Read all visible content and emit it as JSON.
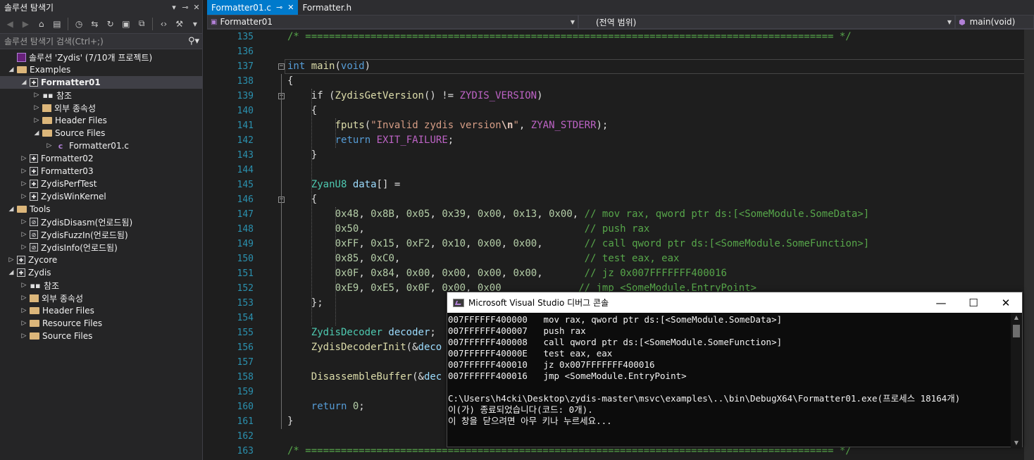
{
  "solution_explorer": {
    "title": "솔루션 탐색기",
    "search_placeholder": "솔루션 탐색기 검색(Ctrl+;)",
    "tree": [
      {
        "label": "솔루션 'Zydis' (7/10개 프로젝트)",
        "depth": 0,
        "expander": "",
        "icon": "solution-icon"
      },
      {
        "label": "Examples",
        "depth": 0,
        "expander": "◢",
        "icon": "folder-icon"
      },
      {
        "label": "Formatter01",
        "depth": 1,
        "expander": "◢",
        "icon": "project-icon",
        "selected": true
      },
      {
        "label": "참조",
        "depth": 2,
        "expander": "▷",
        "icon": "references-icon"
      },
      {
        "label": "외부 종속성",
        "depth": 2,
        "expander": "▷",
        "icon": "external-deps-icon"
      },
      {
        "label": "Header Files",
        "depth": 2,
        "expander": "▷",
        "icon": "folder-icon"
      },
      {
        "label": "Source Files",
        "depth": 2,
        "expander": "◢",
        "icon": "folder-icon"
      },
      {
        "label": "Formatter01.c",
        "depth": 3,
        "expander": "▷",
        "icon": "c-file-icon"
      },
      {
        "label": "Formatter02",
        "depth": 1,
        "expander": "▷",
        "icon": "project-icon"
      },
      {
        "label": "Formatter03",
        "depth": 1,
        "expander": "▷",
        "icon": "project-icon"
      },
      {
        "label": "ZydisPerfTest",
        "depth": 1,
        "expander": "▷",
        "icon": "project-icon"
      },
      {
        "label": "ZydisWinKernel",
        "depth": 1,
        "expander": "▷",
        "icon": "project-icon"
      },
      {
        "label": "Tools",
        "depth": 0,
        "expander": "◢",
        "icon": "folder-icon"
      },
      {
        "label": "ZydisDisasm(언로드됨)",
        "depth": 1,
        "expander": "▷",
        "icon": "unloaded-project-icon"
      },
      {
        "label": "ZydisFuzzIn(언로드됨)",
        "depth": 1,
        "expander": "▷",
        "icon": "unloaded-project-icon"
      },
      {
        "label": "ZydisInfo(언로드됨)",
        "depth": 1,
        "expander": "▷",
        "icon": "unloaded-project-icon"
      },
      {
        "label": "Zycore",
        "depth": 0,
        "expander": "▷",
        "icon": "project-icon"
      },
      {
        "label": "Zydis",
        "depth": 0,
        "expander": "◢",
        "icon": "project-icon"
      },
      {
        "label": "참조",
        "depth": 1,
        "expander": "▷",
        "icon": "references-icon"
      },
      {
        "label": "외부 종속성",
        "depth": 1,
        "expander": "▷",
        "icon": "external-deps-icon"
      },
      {
        "label": "Header Files",
        "depth": 1,
        "expander": "▷",
        "icon": "folder-icon"
      },
      {
        "label": "Resource Files",
        "depth": 1,
        "expander": "▷",
        "icon": "folder-icon"
      },
      {
        "label": "Source Files",
        "depth": 1,
        "expander": "▷",
        "icon": "folder-icon"
      }
    ]
  },
  "tabs": [
    {
      "label": "Formatter01.c",
      "active": true,
      "pin": "⊸",
      "close": "✕"
    },
    {
      "label": "Formatter.h",
      "active": false
    }
  ],
  "navbar": {
    "file_scope": "Formatter01",
    "scope": "(전역 범위)",
    "member": "main(void)"
  },
  "editor": {
    "lines": [
      {
        "n": "135",
        "html": "<span class=\"cm\">/* ========================================================================================= */</span>",
        "indent": 0
      },
      {
        "n": "136",
        "html": "",
        "indent": 0
      },
      {
        "n": "137",
        "html": "<span class=\"kw\">int</span> <span class=\"fn\">main</span>(<span class=\"kw\">void</span>)",
        "indent": 0,
        "fold": "−"
      },
      {
        "n": "138",
        "html": "{",
        "indent": 0
      },
      {
        "n": "139",
        "html": "if (<span class=\"fn\">ZydisGetVersion</span>() != <span class=\"mc\">ZYDIS_VERSION</span>)",
        "indent": 1,
        "fold": "−"
      },
      {
        "n": "140",
        "html": "{",
        "indent": 1
      },
      {
        "n": "141",
        "html": "<span class=\"fn\">fputs</span>(<span class=\"st\">\"Invalid zydis version</span><span class=\"es\">\\n</span><span class=\"st\">\"</span>, <span class=\"mc\">ZYAN_STDERR</span>);",
        "indent": 2
      },
      {
        "n": "142",
        "html": "<span class=\"kw\">return</span> <span class=\"mc\">EXIT_FAILURE</span>;",
        "indent": 2
      },
      {
        "n": "143",
        "html": "}",
        "indent": 1
      },
      {
        "n": "144",
        "html": "",
        "indent": 0
      },
      {
        "n": "145",
        "html": "<span class=\"ty\">ZyanU8</span> <span class=\"vr\">data</span>[] =",
        "indent": 1
      },
      {
        "n": "146",
        "html": "{",
        "indent": 1,
        "fold": "−"
      },
      {
        "n": "147",
        "html": "<span class=\"nm\">0x48</span>, <span class=\"nm\">0x8B</span>, <span class=\"nm\">0x05</span>, <span class=\"nm\">0x39</span>, <span class=\"nm\">0x00</span>, <span class=\"nm\">0x13</span>, <span class=\"nm\">0x00</span>, <span class=\"cm\">// mov rax, qword ptr ds:[&lt;SomeModule.SomeData&gt;]</span>",
        "indent": 2
      },
      {
        "n": "148",
        "html": "<span class=\"nm\">0x50</span>,                                     <span class=\"cm\">// push rax</span>",
        "indent": 2
      },
      {
        "n": "149",
        "html": "<span class=\"nm\">0xFF</span>, <span class=\"nm\">0x15</span>, <span class=\"nm\">0xF2</span>, <span class=\"nm\">0x10</span>, <span class=\"nm\">0x00</span>, <span class=\"nm\">0x00</span>,       <span class=\"cm\">// call qword ptr ds:[&lt;SomeModule.SomeFunction&gt;]</span>",
        "indent": 2
      },
      {
        "n": "150",
        "html": "<span class=\"nm\">0x85</span>, <span class=\"nm\">0xC0</span>,                               <span class=\"cm\">// test eax, eax</span>",
        "indent": 2
      },
      {
        "n": "151",
        "html": "<span class=\"nm\">0x0F</span>, <span class=\"nm\">0x84</span>, <span class=\"nm\">0x00</span>, <span class=\"nm\">0x00</span>, <span class=\"nm\">0x00</span>, <span class=\"nm\">0x00</span>,       <span class=\"cm\">// jz 0x007FFFFFFF400016</span>",
        "indent": 2
      },
      {
        "n": "152",
        "html": "<span class=\"nm\">0xE9</span>, <span class=\"nm\">0xE5</span>, <span class=\"nm\">0x0F</span>, <span class=\"nm\">0x00</span>, <span class=\"nm\">0x00</span>             <span class=\"cm\">// jmp &lt;SomeModule.EntryPoint&gt;</span>",
        "indent": 2
      },
      {
        "n": "153",
        "html": "};",
        "indent": 1
      },
      {
        "n": "154",
        "html": "",
        "indent": 0
      },
      {
        "n": "155",
        "html": "<span class=\"ty\">ZydisDecoder</span> <span class=\"vr\">decoder</span>;",
        "indent": 1
      },
      {
        "n": "156",
        "html": "<span class=\"fn\">ZydisDecoderInit</span>(&amp;<span class=\"vr\">deco</span>",
        "indent": 1
      },
      {
        "n": "157",
        "html": "",
        "indent": 0
      },
      {
        "n": "158",
        "html": "<span class=\"fn\">DisassembleBuffer</span>(&amp;<span class=\"vr\">dec</span>",
        "indent": 1
      },
      {
        "n": "159",
        "html": "",
        "indent": 0
      },
      {
        "n": "160",
        "html": "<span class=\"kw\">return</span> <span class=\"nm\">0</span>;",
        "indent": 1
      },
      {
        "n": "161",
        "html": "}",
        "indent": 0
      },
      {
        "n": "162",
        "html": "",
        "indent": 0
      },
      {
        "n": "163",
        "html": "<span class=\"cm\">/* ========================================================================================= */</span>",
        "indent": 0
      }
    ]
  },
  "console": {
    "title": "Microsoft Visual Studio 디버그 콘솔",
    "minimize": "—",
    "maximize": "☐",
    "close": "✕",
    "lines": [
      "007FFFFFF400000   mov rax, qword ptr ds:[<SomeModule.SomeData>]",
      "007FFFFFF400007   push rax",
      "007FFFFFF400008   call qword ptr ds:[<SomeModule.SomeFunction>]",
      "007FFFFFF40000E   test eax, eax",
      "007FFFFFF400010   jz 0x007FFFFFFF400016",
      "007FFFFFF400016   jmp <SomeModule.EntryPoint>",
      "",
      "C:\\Users\\h4cki\\Desktop\\zydis-master\\msvc\\examples\\..\\bin\\DebugX64\\Formatter01.exe(프로세스 18164개)",
      "이(가) 종료되었습니다(코드: 0개).",
      "이 창을 닫으려면 아무 키나 누르세요..."
    ]
  }
}
